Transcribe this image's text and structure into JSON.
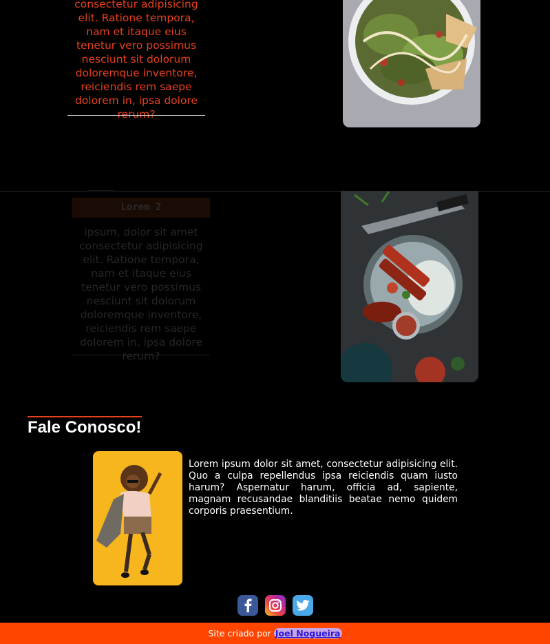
{
  "section1": {
    "text": "consectetur adipisicing elit. Ratione tempora, nam et itaque eius tenetur vero possimus nesciunt sit dolorum doloremque inventore, reiciendis rem saepe dolorem in, ipsa dolore rerum?",
    "image": "salad-photo"
  },
  "section2": {
    "title": "Lorem 2",
    "text": "ipsum, dolor sit amet consectetur adipisicing elit. Ratione tempora, nam et itaque eius tenetur vero possimus nesciunt sit dolorum doloremque inventore, reiciendis rem saepe dolorem in, ipsa dolore rerum?",
    "image": "skewers-photo"
  },
  "contact": {
    "title": "Fale Conosco!",
    "text": "Lorem ipsum dolor sit amet, consectetur adipisicing elit. Quo a culpa repellendus ipsa reiciendis quam iusto harum? Aspernatur harum, officia ad, sapiente, magnam recusandae blanditiis beatae nemo quidem corporis praesentium.",
    "image": "person-photo"
  },
  "social": [
    {
      "name": "facebook-icon",
      "color": "#3b5998"
    },
    {
      "name": "instagram-icon",
      "color": "#c1279a"
    },
    {
      "name": "twitter-icon",
      "color": "#4aa8e8"
    }
  ],
  "footer": {
    "prefix": "Site criado por",
    "link": "Joel Nogueira",
    "background": "#ff4500"
  },
  "colors": {
    "accent": "#e8401c",
    "background": "#000000"
  }
}
